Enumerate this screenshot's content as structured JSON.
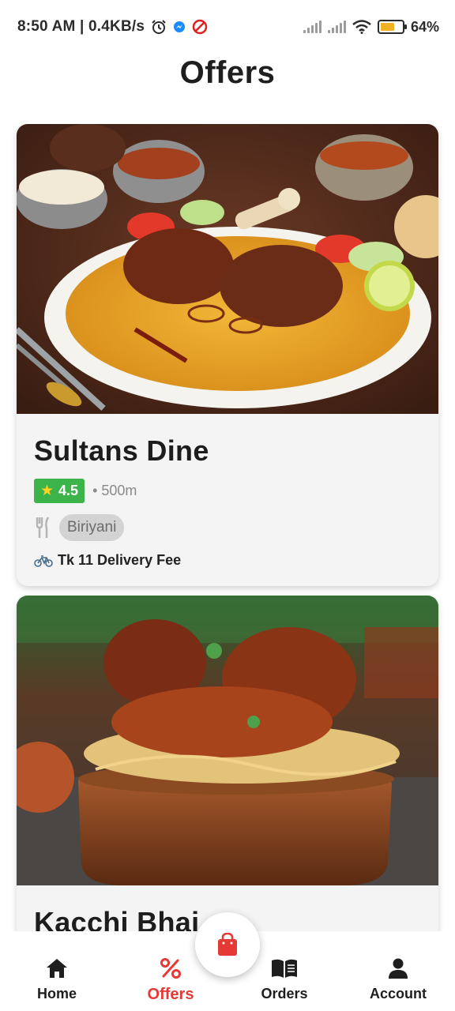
{
  "status_bar": {
    "time_speed": "8:50 AM | 0.4KB/s",
    "battery": "64%",
    "battery_level": 0.64,
    "icons": [
      "alarm-icon",
      "messenger-icon",
      "blocked-icon",
      "signal-icon",
      "signal-icon",
      "wifi-icon",
      "battery-icon"
    ]
  },
  "header": {
    "title": "Offers"
  },
  "offers": [
    {
      "name": "Sultans Dine",
      "rating": "4.5",
      "distance": "• 500m",
      "cuisine": "Biriyani",
      "delivery_fee": "Tk 11 Delivery Fee",
      "image": "mutton-biriyani-plate-photo"
    },
    {
      "name": "Kacchi Bhai",
      "image": "kacchi-biriyani-pot-photo"
    }
  ],
  "bottom_nav": {
    "items": [
      {
        "label": "Home",
        "icon": "home-icon"
      },
      {
        "label": "Offers",
        "icon": "percent-icon",
        "active": true
      },
      {
        "label": "Orders",
        "icon": "book-icon"
      },
      {
        "label": "Account",
        "icon": "person-icon"
      }
    ],
    "fab_icon": "shopping-bag-icon"
  },
  "colors": {
    "accent": "#e53935",
    "rating_green": "#3cb44a",
    "card_bg": "#f4f4f4",
    "tag_bg": "#d3d3d3"
  }
}
